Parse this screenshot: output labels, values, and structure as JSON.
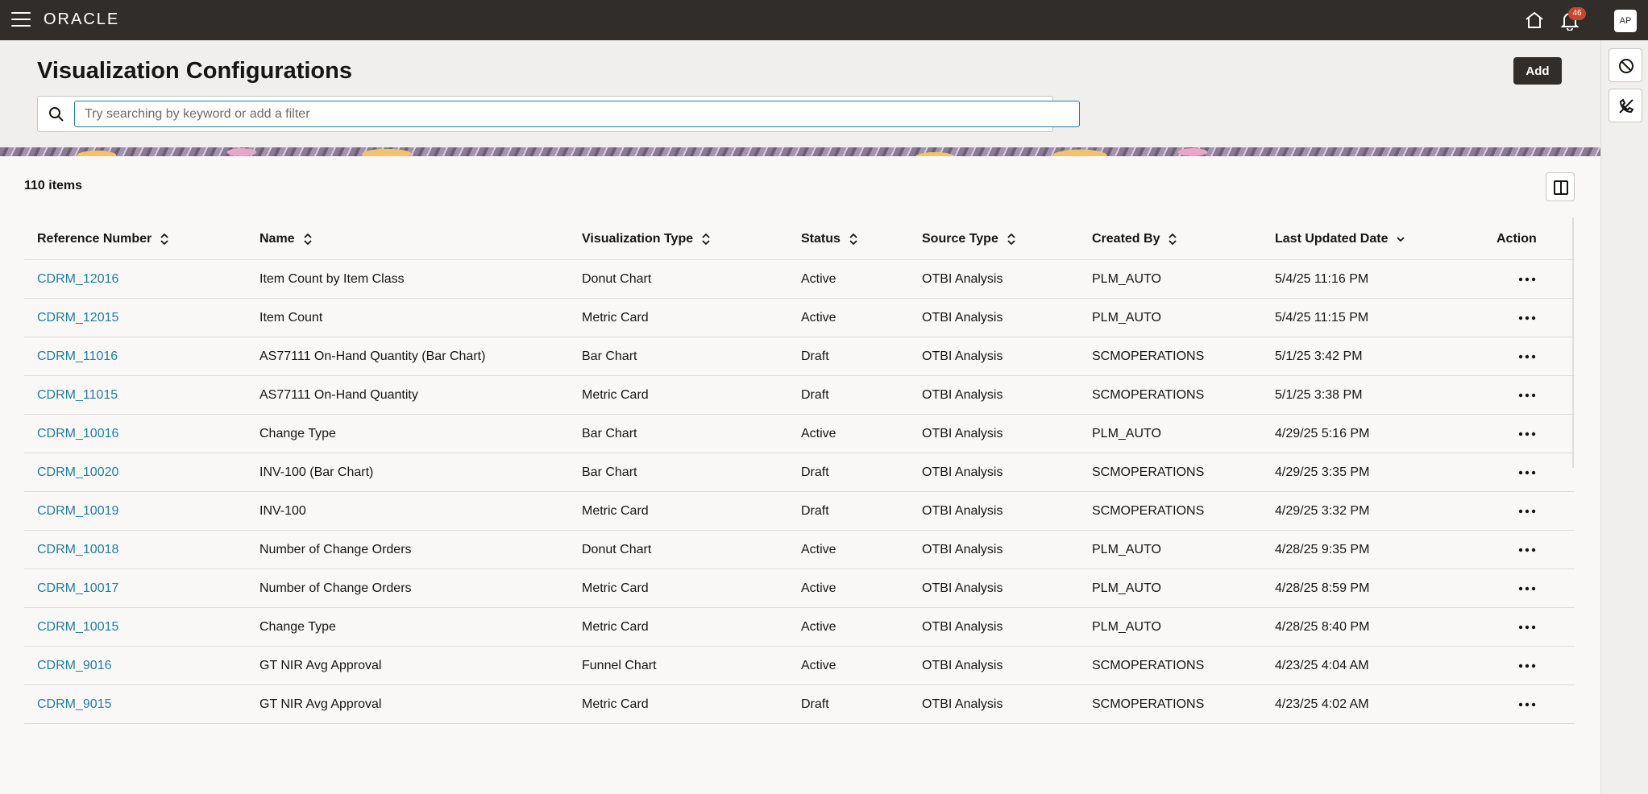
{
  "topbar": {
    "logo": "ORACLE",
    "notification_count": "46",
    "avatar_initials": "AP"
  },
  "header": {
    "title": "Visualization Configurations",
    "add_label": "Add",
    "search_placeholder": "Try searching by keyword or add a filter"
  },
  "results": {
    "count_label": "110 items"
  },
  "table": {
    "columns": [
      {
        "label": "Reference Number",
        "sort": "both"
      },
      {
        "label": "Name",
        "sort": "both"
      },
      {
        "label": "Visualization Type",
        "sort": "both"
      },
      {
        "label": "Status",
        "sort": "both"
      },
      {
        "label": "Source Type",
        "sort": "both"
      },
      {
        "label": "Created By",
        "sort": "both"
      },
      {
        "label": "Last Updated Date",
        "sort": "descending"
      },
      {
        "label": "Action",
        "sort": "none"
      }
    ],
    "rows": [
      {
        "ref": "CDRM_12016",
        "name": "Item Count by Item Class",
        "vtype": "Donut Chart",
        "status": "Active",
        "source": "OTBI Analysis",
        "created_by": "PLM_AUTO",
        "updated": "5/4/25 11:16 PM"
      },
      {
        "ref": "CDRM_12015",
        "name": "Item Count",
        "vtype": "Metric Card",
        "status": "Active",
        "source": "OTBI Analysis",
        "created_by": "PLM_AUTO",
        "updated": "5/4/25 11:15 PM"
      },
      {
        "ref": "CDRM_11016",
        "name": "AS77111 On-Hand Quantity (Bar Chart)",
        "vtype": "Bar Chart",
        "status": "Draft",
        "source": "OTBI Analysis",
        "created_by": "SCMOPERATIONS",
        "updated": "5/1/25 3:42 PM"
      },
      {
        "ref": "CDRM_11015",
        "name": "AS77111 On-Hand Quantity",
        "vtype": "Metric Card",
        "status": "Draft",
        "source": "OTBI Analysis",
        "created_by": "SCMOPERATIONS",
        "updated": "5/1/25 3:38 PM"
      },
      {
        "ref": "CDRM_10016",
        "name": "Change Type",
        "vtype": "Bar Chart",
        "status": "Active",
        "source": "OTBI Analysis",
        "created_by": "PLM_AUTO",
        "updated": "4/29/25 5:16 PM"
      },
      {
        "ref": "CDRM_10020",
        "name": "INV-100 (Bar Chart)",
        "vtype": "Bar Chart",
        "status": "Draft",
        "source": "OTBI Analysis",
        "created_by": "SCMOPERATIONS",
        "updated": "4/29/25 3:35 PM"
      },
      {
        "ref": "CDRM_10019",
        "name": "INV-100",
        "vtype": "Metric Card",
        "status": "Draft",
        "source": "OTBI Analysis",
        "created_by": "SCMOPERATIONS",
        "updated": "4/29/25 3:32 PM"
      },
      {
        "ref": "CDRM_10018",
        "name": "Number of Change Orders",
        "vtype": "Donut Chart",
        "status": "Active",
        "source": "OTBI Analysis",
        "created_by": "PLM_AUTO",
        "updated": "4/28/25 9:35 PM"
      },
      {
        "ref": "CDRM_10017",
        "name": "Number of Change Orders",
        "vtype": "Metric Card",
        "status": "Active",
        "source": "OTBI Analysis",
        "created_by": "PLM_AUTO",
        "updated": "4/28/25 8:59 PM"
      },
      {
        "ref": "CDRM_10015",
        "name": "Change Type",
        "vtype": "Metric Card",
        "status": "Active",
        "source": "OTBI Analysis",
        "created_by": "PLM_AUTO",
        "updated": "4/28/25 8:40 PM"
      },
      {
        "ref": "CDRM_9016",
        "name": "GT NIR Avg Approval",
        "vtype": "Funnel Chart",
        "status": "Active",
        "source": "OTBI Analysis",
        "created_by": "SCMOPERATIONS",
        "updated": "4/23/25 4:04 AM"
      },
      {
        "ref": "CDRM_9015",
        "name": "GT NIR Avg Approval",
        "vtype": "Metric Card",
        "status": "Draft",
        "source": "OTBI Analysis",
        "created_by": "SCMOPERATIONS",
        "updated": "4/23/25 4:02 AM"
      }
    ]
  },
  "icons": {
    "menu": "hamburger-menu-icon",
    "home": "home-icon",
    "notifications": "bell-icon",
    "search": "search-icon",
    "columns": "columns-panel-icon",
    "row_actions": "more-horizontal-icon",
    "rail_block": "block-icon",
    "rail_no_call": "phone-off-icon"
  },
  "colors": {
    "topbar_bg": "#312d2a",
    "link": "#227e9e",
    "badge": "#c74634",
    "header_bg": "#f1efed"
  }
}
